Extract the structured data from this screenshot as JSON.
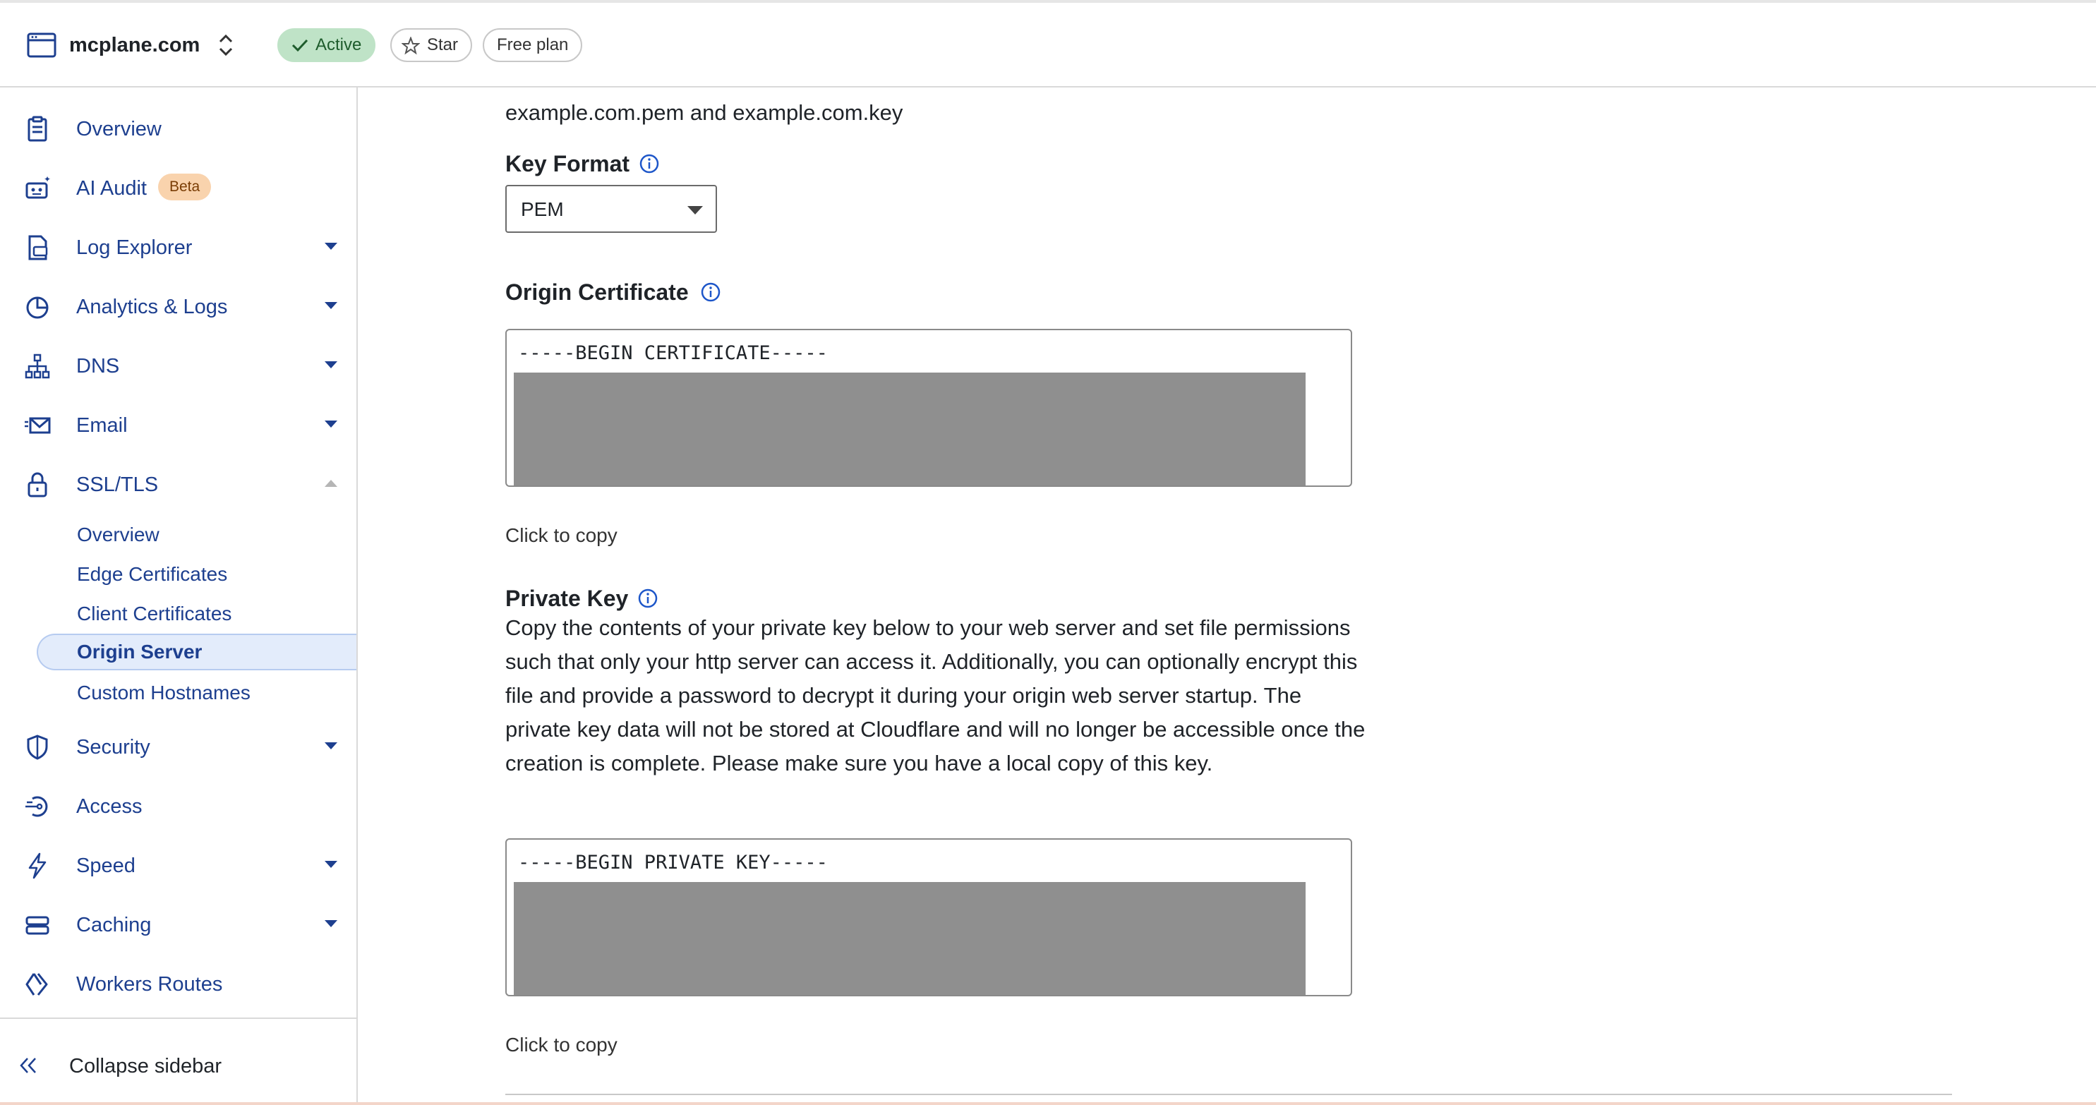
{
  "header": {
    "site_name": "mcplane.com",
    "status_badge": "Active",
    "star_label": "Star",
    "plan_label": "Free plan"
  },
  "sidebar": {
    "items": [
      {
        "label": "Overview",
        "icon": "clipboard-icon"
      },
      {
        "label": "AI Audit",
        "icon": "robot-icon",
        "badge": "Beta"
      },
      {
        "label": "Log Explorer",
        "icon": "log-file-icon"
      },
      {
        "label": "Analytics & Logs",
        "icon": "pie-chart-icon"
      },
      {
        "label": "DNS",
        "icon": "network-icon"
      },
      {
        "label": "Email",
        "icon": "envelope-icon"
      },
      {
        "label": "SSL/TLS",
        "icon": "lock-icon"
      },
      {
        "label": "Security",
        "icon": "shield-icon"
      },
      {
        "label": "Access",
        "icon": "access-icon"
      },
      {
        "label": "Speed",
        "icon": "lightning-icon"
      },
      {
        "label": "Caching",
        "icon": "server-stack-icon"
      },
      {
        "label": "Workers Routes",
        "icon": "workers-icon"
      }
    ],
    "ssl_subitems": [
      {
        "label": "Overview"
      },
      {
        "label": "Edge Certificates"
      },
      {
        "label": "Client Certificates"
      },
      {
        "label": "Origin Server",
        "selected": true
      },
      {
        "label": "Custom Hostnames"
      }
    ],
    "collapse_label": "Collapse sidebar"
  },
  "main": {
    "intro_tail": "example.com.pem and example.com.key",
    "key_format": {
      "title": "Key Format",
      "selected": "PEM"
    },
    "origin_certificate": {
      "title": "Origin Certificate",
      "first_line": "-----BEGIN CERTIFICATE-----",
      "copy_label": "Click to copy"
    },
    "private_key": {
      "title": "Private Key",
      "description": "Copy the contents of your private key below to your web server and set file permissions such that only your http server can access it. Additionally, you can optionally encrypt this file and provide a password to decrypt it during your origin web server startup. The private key data will not be stored at Cloudflare and will no longer be accessible once the creation is complete. Please make sure you have a local copy of this key.",
      "first_line": "-----BEGIN PRIVATE KEY-----",
      "copy_label": "Click to copy"
    }
  },
  "colors": {
    "nav_text": "#1d3f8f",
    "active_badge_bg": "#bfe3c7",
    "beta_badge_bg": "#f9d3ad",
    "selected_bg": "#e3ecfb",
    "redaction": "#8f8f8f"
  }
}
